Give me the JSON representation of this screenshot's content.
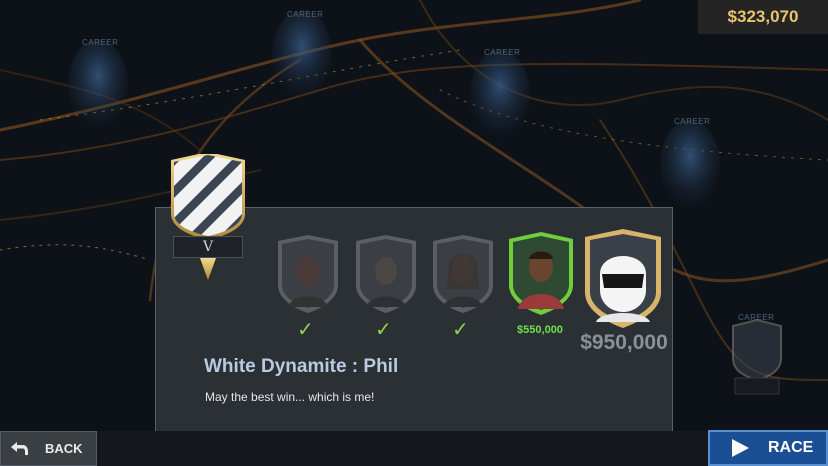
{
  "balance": "$323,070",
  "map": {
    "career_labels": [
      "CAREER",
      "CAREER",
      "CAREER",
      "CAREER",
      "CAREER"
    ]
  },
  "tier": {
    "numeral": "V"
  },
  "opponents": [
    {
      "name": "opponent-1",
      "status": "defeated",
      "check": "✓"
    },
    {
      "name": "opponent-2",
      "status": "defeated",
      "check": "✓"
    },
    {
      "name": "opponent-3",
      "status": "defeated",
      "check": "✓"
    },
    {
      "name": "opponent-current",
      "status": "current",
      "reward": "$550,000"
    },
    {
      "name": "the-stig-boss",
      "status": "boss",
      "reward": "$950,000"
    }
  ],
  "rival": {
    "name": "White Dynamite : Phil",
    "quote": "May the best win... which is me!"
  },
  "buttons": {
    "back": "BACK",
    "race": "RACE"
  },
  "colors": {
    "accent": "#1a4f96",
    "gold": "#d8b56a",
    "reward_green": "#6ee24a",
    "check_green": "#8ed34a"
  }
}
